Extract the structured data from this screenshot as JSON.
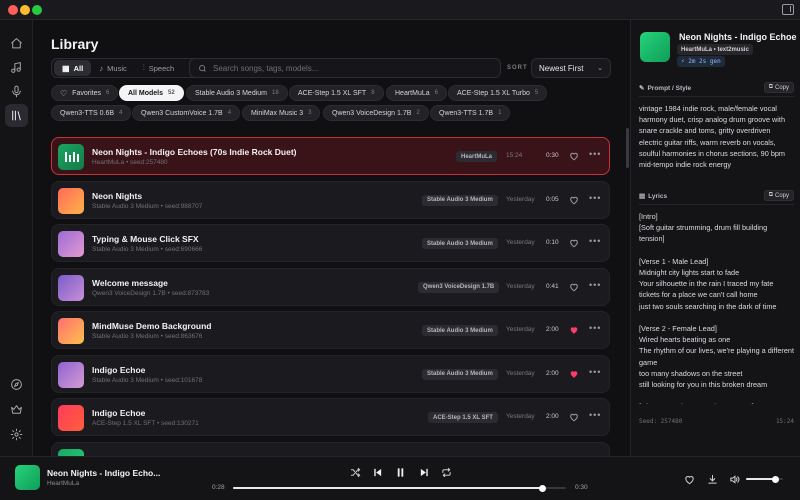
{
  "nav": {
    "items": [
      {
        "icon": "home-icon",
        "active": false
      },
      {
        "icon": "music-note-icon",
        "active": false
      },
      {
        "icon": "microphone-icon",
        "active": false
      },
      {
        "icon": "library-icon",
        "active": true
      }
    ],
    "bottom": [
      {
        "icon": "compass-icon"
      },
      {
        "icon": "crown-icon"
      },
      {
        "icon": "gear-icon"
      }
    ]
  },
  "library": {
    "title": "Library",
    "filters": [
      {
        "label": "All",
        "icon": "grid-icon",
        "active": true
      },
      {
        "label": "Music",
        "icon": "music-note-icon",
        "active": false
      },
      {
        "label": "Speech",
        "icon": "waveform-icon",
        "active": false
      }
    ],
    "search_placeholder": "Search songs, tags, models...",
    "sort_label": "SORT",
    "sort_value": "Newest First",
    "chips": [
      {
        "label": "Favorites",
        "count": "6",
        "icon": "heart-outline-icon",
        "active": false
      },
      {
        "label": "All Models",
        "count": "52",
        "active": true
      },
      {
        "label": "Stable Audio 3 Medium",
        "count": "18",
        "active": false
      },
      {
        "label": "ACE-Step 1.5 XL SFT",
        "count": "8",
        "active": false
      },
      {
        "label": "HeartMuLa",
        "count": "6",
        "active": false
      },
      {
        "label": "ACE-Step 1.5 XL Turbo",
        "count": "5",
        "active": false
      },
      {
        "label": "Qwen3-TTS 0.6B",
        "count": "4",
        "active": false
      },
      {
        "label": "Qwen3 CustomVoice 1.7B",
        "count": "4",
        "active": false
      },
      {
        "label": "MiniMax Music 3",
        "count": "3",
        "active": false
      },
      {
        "label": "Qwen3 VoiceDesign 1.7B",
        "count": "2",
        "active": false
      },
      {
        "label": "Qwen3-TTS 1.7B",
        "count": "1",
        "active": false
      }
    ],
    "rows": [
      {
        "title": "Neon Nights - Indigo Echoes (70s Indie Rock Duet)",
        "subtitle": "HeartMuLa • seed:257480",
        "model": "HeartMuLa",
        "time": "15:24",
        "duration": "0:30",
        "favorite": false,
        "selected": true,
        "thumb": "bars",
        "color1": "#1aa563",
        "color2": "#137a48"
      },
      {
        "title": "Neon Nights",
        "subtitle": "Stable Audio 3 Medium • seed:988707",
        "model": "Stable Audio 3 Medium",
        "time": "Yesterday",
        "duration": "0:05",
        "favorite": false,
        "selected": false,
        "thumb": "plain",
        "color1": "#ff6a5a",
        "color2": "#ffb347"
      },
      {
        "title": "Typing & Mouse Click SFX",
        "subtitle": "Stable Audio 3 Medium • seed:690666",
        "model": "Stable Audio 3 Medium",
        "time": "Yesterday",
        "duration": "0:10",
        "favorite": false,
        "selected": false,
        "thumb": "plain",
        "color1": "#9b6bd6",
        "color2": "#e49ad0"
      },
      {
        "title": "Welcome message",
        "subtitle": "Qwen3 VoiceDesign 1.7B • seed:873783",
        "model": "Qwen3 VoiceDesign 1.7B",
        "time": "Yesterday",
        "duration": "0:41",
        "favorite": false,
        "selected": false,
        "thumb": "plain",
        "color1": "#7a5cc8",
        "color2": "#c98fd8"
      },
      {
        "title": "MindMuse Demo Background",
        "subtitle": "Stable Audio 3 Medium • seed:863676",
        "model": "Stable Audio 3 Medium",
        "time": "Yesterday",
        "duration": "2:00",
        "favorite": true,
        "selected": false,
        "thumb": "plain",
        "color1": "#ff6f6f",
        "color2": "#ffc04d"
      },
      {
        "title": "Indigo Echoe",
        "subtitle": "Stable Audio 3 Medium • seed:101678",
        "model": "Stable Audio 3 Medium",
        "time": "Yesterday",
        "duration": "2:00",
        "favorite": true,
        "selected": false,
        "thumb": "plain",
        "color1": "#8c63d0",
        "color2": "#d89bd2"
      },
      {
        "title": "Indigo Echoe",
        "subtitle": "ACE-Step 1.5 XL SFT • seed:130271",
        "model": "ACE-Step 1.5 XL SFT",
        "time": "Yesterday",
        "duration": "2:00",
        "favorite": false,
        "selected": false,
        "thumb": "plain",
        "color1": "#ff3b5c",
        "color2": "#ff5e3a"
      },
      {
        "title": "",
        "subtitle": "",
        "model": "",
        "time": "",
        "duration": "",
        "favorite": false,
        "selected": false,
        "thumb": "plain",
        "color1": "#1aa563",
        "color2": "#25d37a"
      }
    ]
  },
  "detail": {
    "title": "Neon Nights - Indigo Echoes",
    "meta": "HeartMuLa • text2music",
    "gen_time": "⚡ 2m 2s gen",
    "prompt_heading": "Prompt / Style",
    "copy_label": "Copy",
    "prompt_text": "vintage 1984 indie rock, male/female vocal harmony duet, crisp analog drum groove with snare crackle and toms, gritty overdriven electric guitar riffs, warm reverb on vocals, soulful harmonies in chorus sections, 90 bpm mid-tempo indie rock energy",
    "lyrics_heading": "Lyrics",
    "lyrics": [
      "[Intro]",
      "[Soft guitar strumming, drum fill building tension]",
      "",
      "[Verse 1 - Male Lead]",
      "Midnight city lights start to fade",
      "Your silhouette in the rain I traced my fate tickets for a place we can't call home",
      "just two souls searching in the dark of time",
      "",
      "[Verse 2 - Female Lead]",
      "Wired hearts beating as one",
      "The rhythm of our lives, we're playing a different game",
      "too many shadows on the street",
      "still looking for you in this broken dream",
      "",
      "[Chorus - Male & Female Harmony]"
    ],
    "seed": "Seed: 257480",
    "time": "15:24"
  },
  "player": {
    "title": "Neon Nights - Indigo Echo...",
    "subtitle": "HeartMuLa",
    "elapsed": "0:28",
    "total": "0:30",
    "progress": 0.93,
    "volume": 0.8
  }
}
